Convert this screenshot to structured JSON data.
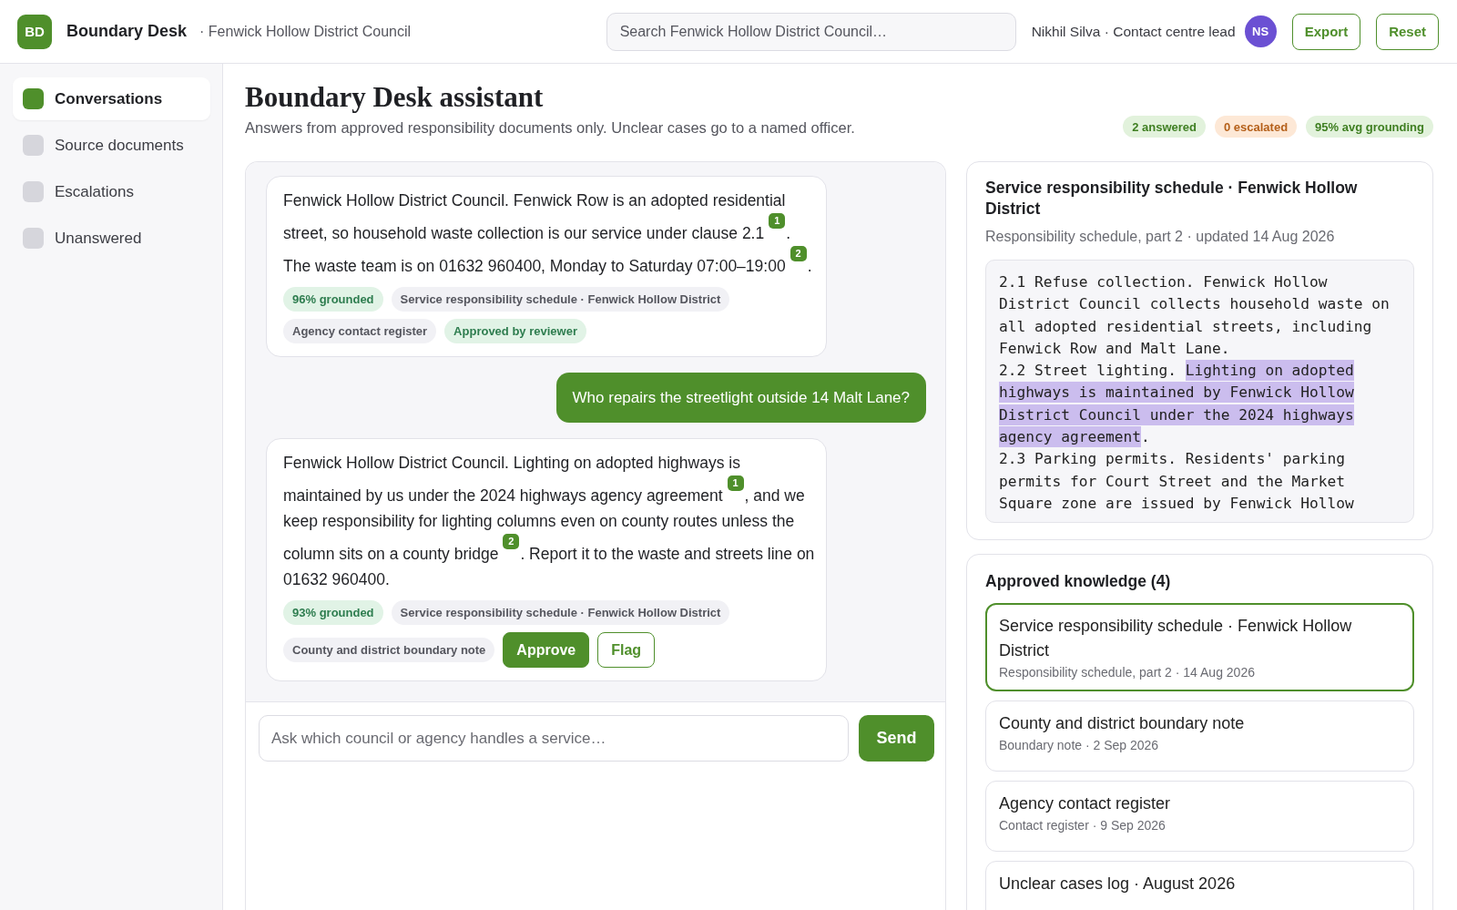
{
  "header": {
    "logo": "BD",
    "app_name": "Boundary Desk",
    "organisation": "· Fenwick Hollow District Council",
    "search": {
      "placeholder": "Search Fenwick Hollow District Council…"
    },
    "user": "Nikhil Silva · Contact centre lead",
    "avatar": "NS",
    "buttons": [
      "Export",
      "Reset"
    ]
  },
  "sidebar": {
    "items": [
      {
        "label": "Conversations",
        "selected": true
      },
      {
        "label": "Source documents",
        "selected": false
      },
      {
        "label": "Escalations",
        "selected": false
      },
      {
        "label": "Unanswered",
        "selected": false
      }
    ]
  },
  "page": {
    "title": "Boundary Desk assistant",
    "subtitle": "Answers from approved responsibility documents only. Unclear cases go to a named officer.",
    "stats": [
      {
        "label": "2 answered",
        "kind": "positive"
      },
      {
        "label": "0 escalated",
        "kind": "warning"
      },
      {
        "label": "95% avg grounding",
        "kind": "positive"
      }
    ]
  },
  "chat": {
    "messages": [
      {
        "kind": "assistant",
        "segments": [
          {
            "kind": "text",
            "text": "Fenwick Hollow District Council. Fenwick Row is an adopted residential street, so household waste collection is our service under clause 2.1"
          },
          {
            "kind": "cite",
            "text": "1"
          },
          {
            "kind": "text",
            "text": ". The waste team is on 01632 960400, Monday to Saturday 07:00–19:00"
          },
          {
            "kind": "cite",
            "text": "2"
          },
          {
            "kind": "text",
            "text": "."
          }
        ],
        "tags": [
          {
            "label": "96% grounded",
            "kind": "grounding"
          },
          {
            "label": "Service responsibility schedule · Fenwick Hollow District",
            "kind": "source"
          },
          {
            "label": "Agency contact register",
            "kind": "source"
          },
          {
            "label": "Approved by reviewer",
            "kind": "status"
          }
        ]
      },
      {
        "kind": "user",
        "text": "Who repairs the streetlight outside 14 Malt Lane?"
      },
      {
        "kind": "assistant",
        "segments": [
          {
            "kind": "text",
            "text": "Fenwick Hollow District Council. Lighting on adopted highways is maintained by us under the 2024 highways agency agreement"
          },
          {
            "kind": "cite",
            "text": "1"
          },
          {
            "kind": "text",
            "text": ", and we keep responsibility for lighting columns even on county routes unless the column sits on a county bridge"
          },
          {
            "kind": "cite",
            "text": "2"
          },
          {
            "kind": "text",
            "text": ". Report it to the waste and streets line on 01632 960400."
          }
        ],
        "tags": [
          {
            "label": "93% grounded",
            "kind": "grounding"
          },
          {
            "label": "Service responsibility schedule · Fenwick Hollow District",
            "kind": "source"
          },
          {
            "label": "County and district boundary note",
            "kind": "source"
          }
        ],
        "actions": [
          {
            "label": "Approve",
            "kind": "primary"
          },
          {
            "label": "Flag",
            "kind": "secondary"
          }
        ]
      }
    ],
    "composer": {
      "placeholder": "Ask which council or agency handles a service…",
      "send": "Send"
    }
  },
  "document": {
    "title": "Service responsibility schedule · Fenwick Hollow District",
    "meta": "Responsibility schedule, part 2 · updated 14 Aug 2026",
    "clauses": [
      {
        "text": "2.1 Refuse collection. Fenwick Hollow District Council collects household waste on all adopted residential streets, including Fenwick Row and Malt Lane."
      },
      {
        "text": "2.2 Street lighting.",
        "highlight": "Lighting on adopted highways is maintained by Fenwick Hollow District Council under the 2024 highways agency agreement",
        "after": "."
      },
      {
        "text": "2.3 Parking permits. Residents' parking permits for Court Street and the Market Square zone are issued by Fenwick Hollow"
      }
    ]
  },
  "knowledge": {
    "title": "Approved knowledge (4)",
    "items": [
      {
        "title": "Service responsibility schedule · Fenwick Hollow District",
        "meta": "Responsibility schedule, part 2 · 14 Aug 2026",
        "selected": true
      },
      {
        "title": "County and district boundary note",
        "meta": "Boundary note · 2 Sep 2026",
        "selected": false
      },
      {
        "title": "Agency contact register",
        "meta": "Contact register · 9 Sep 2026",
        "selected": false
      },
      {
        "title": "Unclear cases log · August 2026",
        "selected": false
      }
    ]
  }
}
